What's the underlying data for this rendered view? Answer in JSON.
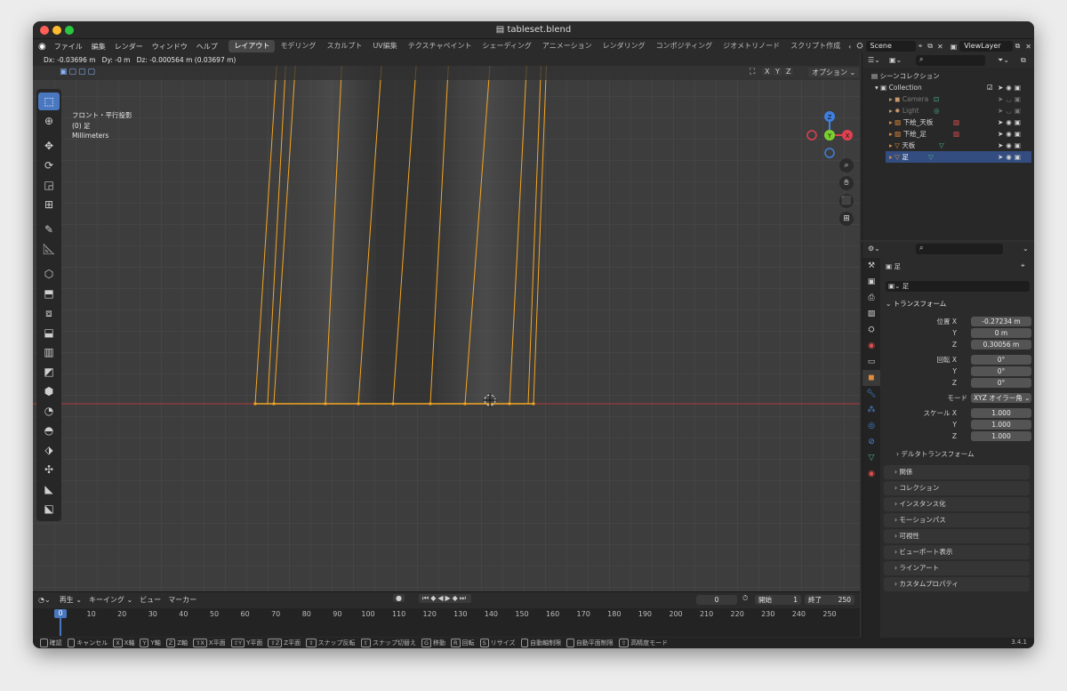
{
  "window": {
    "title": "tableset.blend"
  },
  "menu": [
    "ファイル",
    "編集",
    "レンダー",
    "ウィンドウ",
    "ヘルプ"
  ],
  "workspaces": [
    "レイアウト",
    "モデリング",
    "スカルプト",
    "UV編集",
    "テクスチャペイント",
    "シェーディング",
    "アニメーション",
    "レンダリング",
    "コンポジティング",
    "ジオメトリノード",
    "スクリプト作成"
  ],
  "scene": {
    "name": "Scene"
  },
  "view_layer": {
    "name": "ViewLayer"
  },
  "viewport": {
    "header_text": "Dx: -0.03696 m   Dy: -0 m   Dz: -0.000564 m (0.03697 m)",
    "view_name": "フロント・平行投影",
    "object_label": "(0) 足",
    "units": "Millimeters",
    "options_label": "オプション",
    "axes": [
      "X",
      "Y",
      "Z"
    ],
    "gizmo": {
      "z": "Z",
      "y": "Y",
      "x": "X"
    }
  },
  "outliner": {
    "root": "シーンコレクション",
    "collection": "Collection",
    "items": [
      {
        "name": "Camera",
        "dim": true
      },
      {
        "name": "Light",
        "dim": true
      },
      {
        "name": "下絵_天板",
        "dim": false
      },
      {
        "name": "下絵_足",
        "dim": false
      },
      {
        "name": "天板",
        "dim": false
      },
      {
        "name": "足",
        "dim": false
      }
    ]
  },
  "properties": {
    "object_name": "足",
    "data_name": "足",
    "transform_label": "トランスフォーム",
    "location": {
      "label": "位置",
      "x_label": "X",
      "y_label": "Y",
      "z_label": "Z",
      "x": "-0.27234 m",
      "y": "0 m",
      "z": "0.30056 m"
    },
    "rotation": {
      "label": "回転",
      "x_label": "X",
      "y_label": "Y",
      "z_label": "Z",
      "x": "0°",
      "y": "0°",
      "z": "0°"
    },
    "mode": {
      "label": "モード",
      "value": "XYZ オイラー角"
    },
    "scale": {
      "label": "スケール",
      "x_label": "X",
      "y_label": "Y",
      "z_label": "Z",
      "x": "1.000",
      "y": "1.000",
      "z": "1.000"
    },
    "delta_label": "デルタトランスフォーム",
    "panels": [
      "関係",
      "コレクション",
      "インスタンス化",
      "モーションパス",
      "可視性",
      "ビューポート表示",
      "ラインアート",
      "カスタムプロパティ"
    ]
  },
  "timeline": {
    "playback": "再生",
    "keying": "キーイング",
    "view": "ビュー",
    "marker": "マーカー",
    "current_frame": "0",
    "start_label": "開始",
    "start": "1",
    "end_label": "終了",
    "end": "250",
    "ruler": [
      "0",
      "10",
      "20",
      "30",
      "40",
      "50",
      "60",
      "70",
      "80",
      "90",
      "100",
      "110",
      "120",
      "130",
      "140",
      "150",
      "160",
      "170",
      "180",
      "190",
      "200",
      "210",
      "220",
      "230",
      "240",
      "250"
    ]
  },
  "statusbar": {
    "items": [
      {
        "key": "",
        "label": "確認"
      },
      {
        "key": "",
        "label": "キャンセル"
      },
      {
        "key": "X",
        "label": "X軸"
      },
      {
        "key": "Y",
        "label": "Y軸"
      },
      {
        "key": "Z",
        "label": "Z軸"
      },
      {
        "key": "⇧X",
        "label": "X平面"
      },
      {
        "key": "⇧Y",
        "label": "Y平面"
      },
      {
        "key": "⇧Z",
        "label": "Z平面"
      },
      {
        "key": "⇧",
        "label": "スナップ反転"
      },
      {
        "key": "⇧",
        "label": "スナップ切替え"
      },
      {
        "key": "G",
        "label": "移動"
      },
      {
        "key": "R",
        "label": "回転"
      },
      {
        "key": "S",
        "label": "リサイズ"
      },
      {
        "key": "",
        "label": "自動軸制限"
      },
      {
        "key": "",
        "label": "自動平面制限"
      },
      {
        "key": "⇧",
        "label": "高精度モード"
      }
    ],
    "version": "3.4.1"
  },
  "colors": {
    "accent": "#4a78c0",
    "wire": "#f5a623",
    "x_axis": "#e0404f",
    "y_axis": "#7bcf2f",
    "z_axis": "#3f7fe0"
  }
}
